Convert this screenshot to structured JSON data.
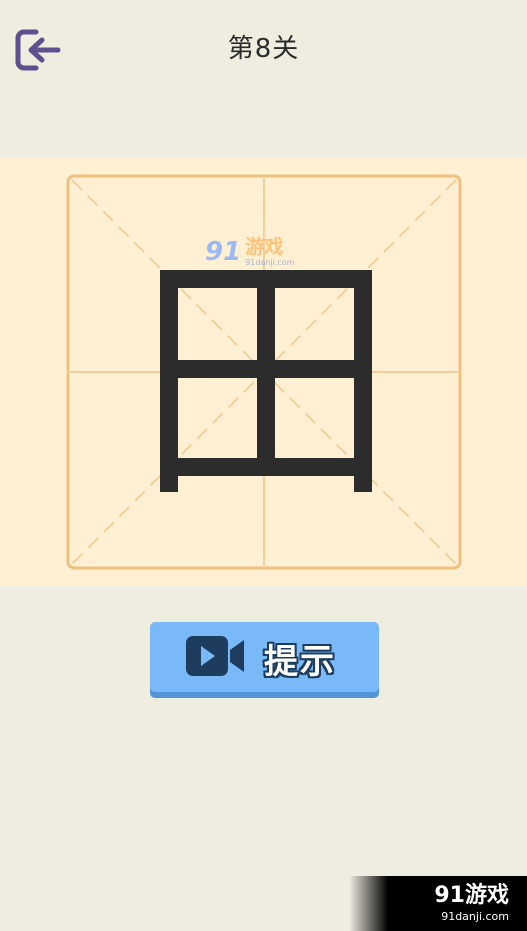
{
  "header": {
    "title": "第8关",
    "back_icon": "exit-arrow-icon"
  },
  "board": {
    "character": "田",
    "grid": "米字格",
    "watermark": {
      "logo": "91",
      "main": "游戏",
      "sub": "91danji.com"
    }
  },
  "hint_button": {
    "label": "提示",
    "icon": "video-camera-icon"
  },
  "corner_watermark": {
    "main": "91游戏",
    "sub": "91danji.com"
  },
  "colors": {
    "background": "#efece0",
    "board_band": "#fff0d4",
    "grid_line": "#f0c690",
    "character": "#2c2c2c",
    "button": "#7ab9f8",
    "button_shadow": "#5393d8",
    "icon": "#5e4f8f"
  }
}
